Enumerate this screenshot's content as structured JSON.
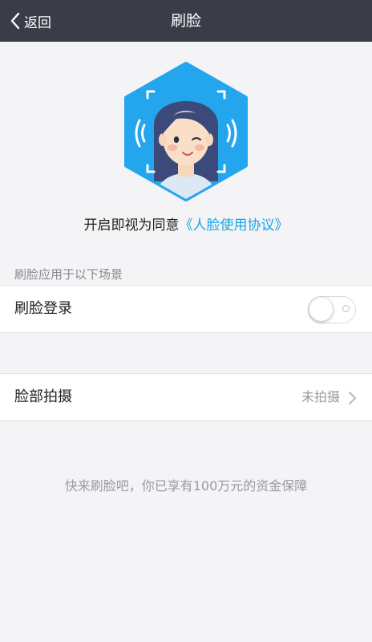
{
  "navbar": {
    "back_label": "返回",
    "title": "刷脸"
  },
  "consent": {
    "text": "开启即视为同意",
    "link": "《人脸使用协议》"
  },
  "section": {
    "header": "刷脸应用于以下场景"
  },
  "face_login": {
    "label": "刷脸登录",
    "enabled": false
  },
  "face_capture": {
    "label": "脸部拍摄",
    "value": "未拍摄"
  },
  "footer": {
    "tagline": "快来刷脸吧，你已享有100万元的资金保障"
  },
  "colors": {
    "navbar": "#3a3d47",
    "accent": "#1aa3e8",
    "background": "#f4f4f6"
  },
  "icons": {
    "back": "chevron-left-icon",
    "hero": "face-scan-hexagon-icon",
    "disclosure": "chevron-right-icon"
  }
}
